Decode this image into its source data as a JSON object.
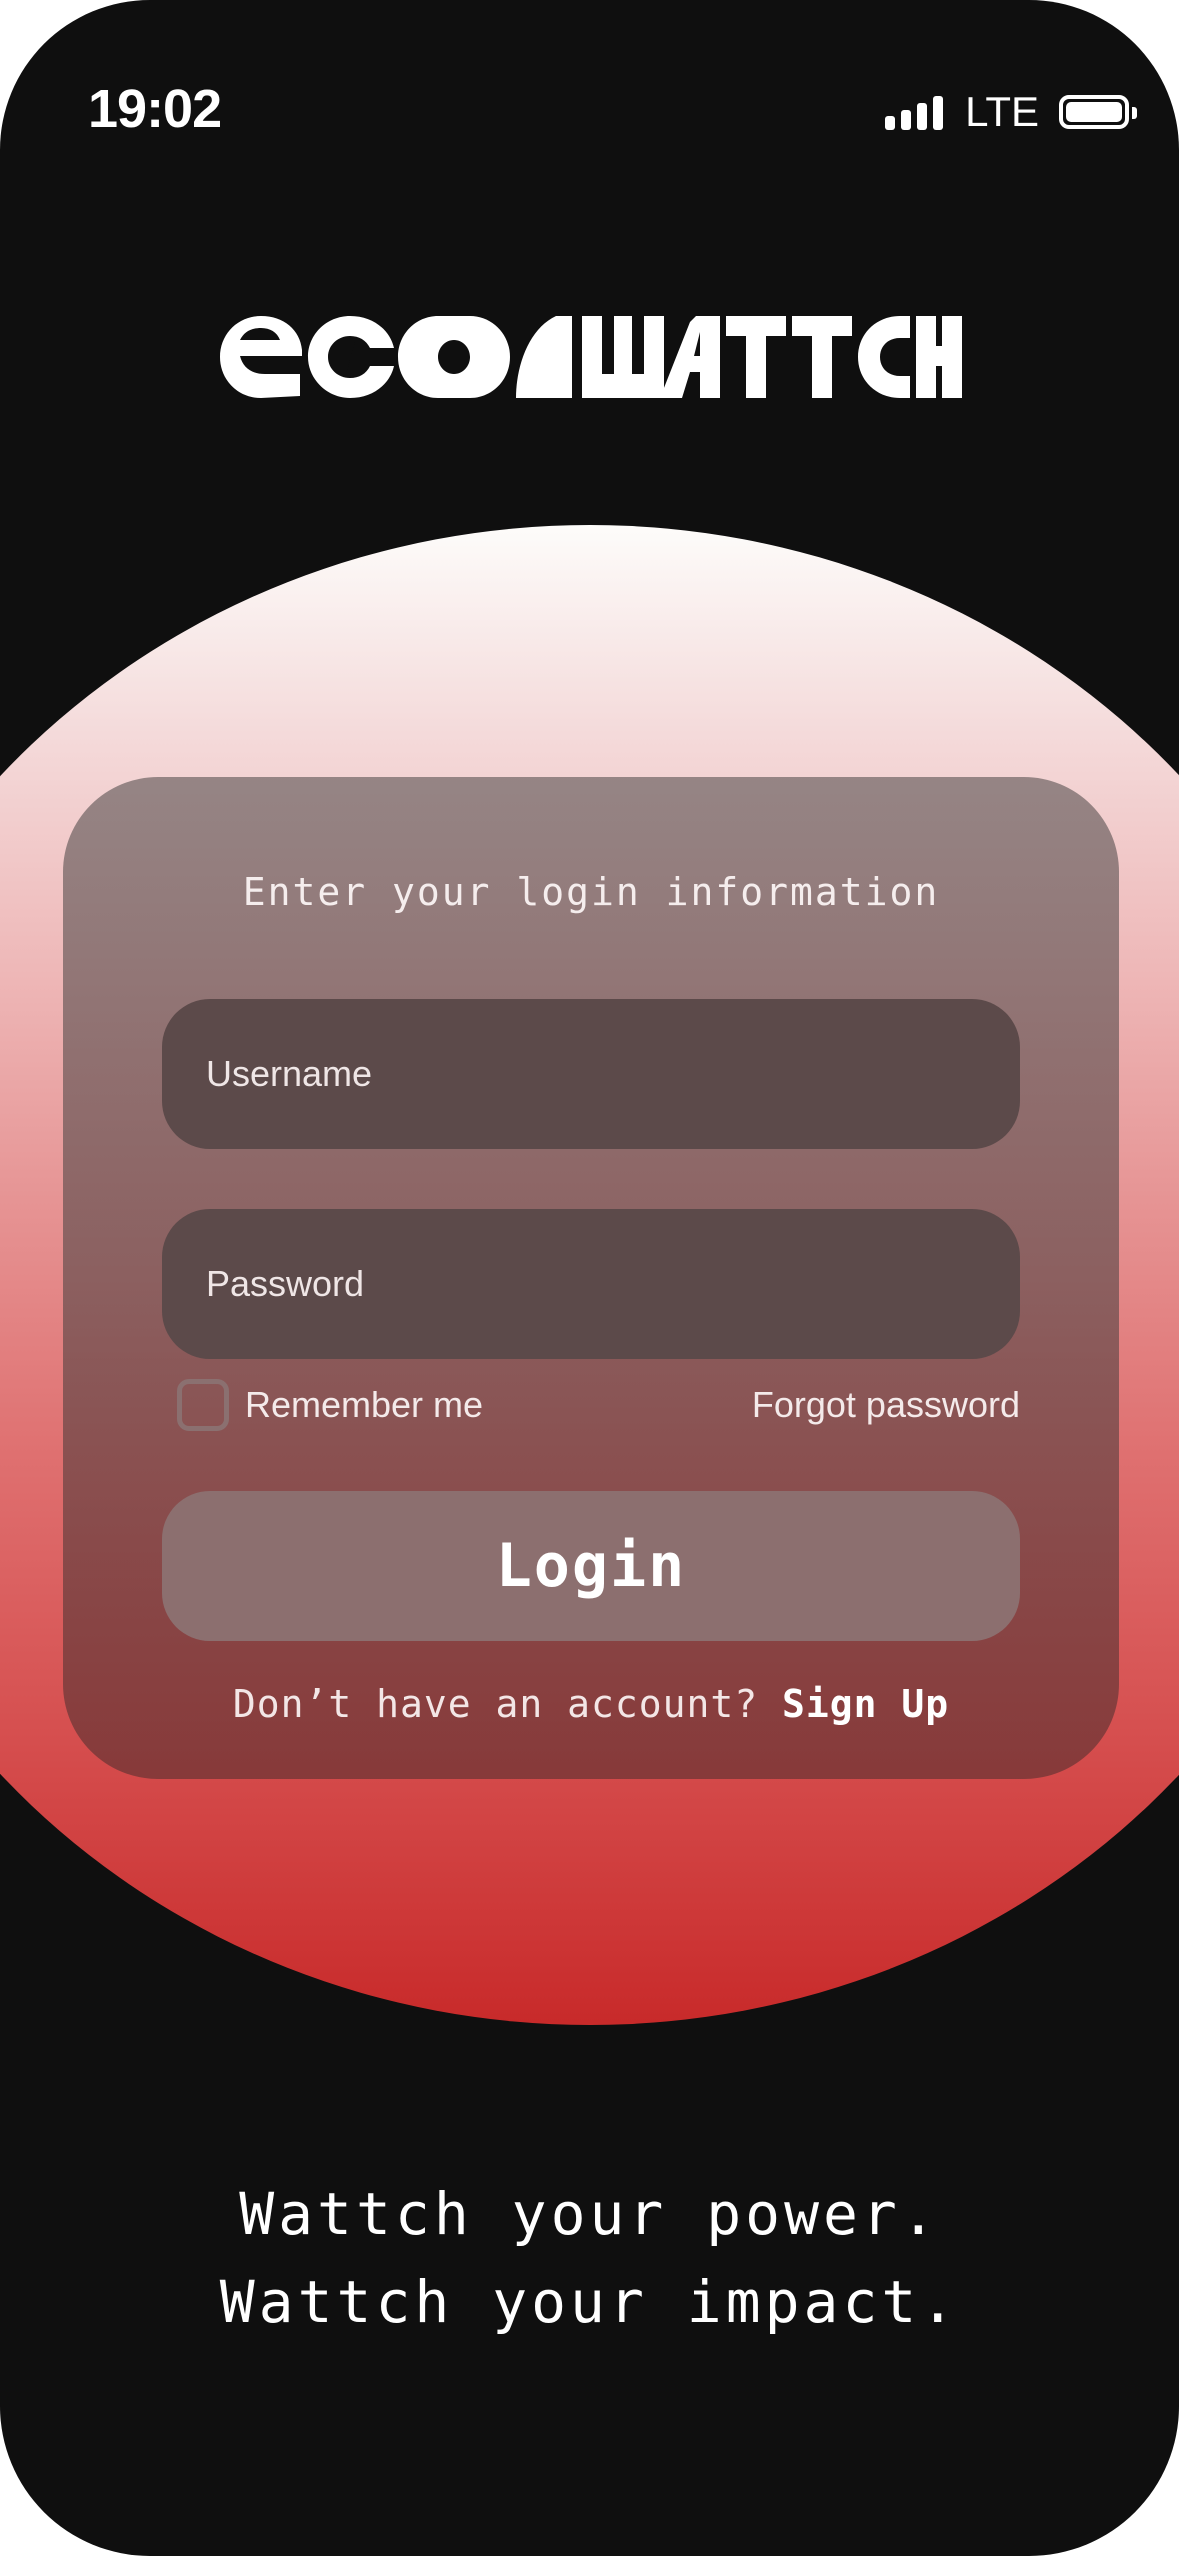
{
  "status_bar": {
    "time": "19:02",
    "network": "LTE",
    "signal-icon": "signal-bars-icon",
    "battery-icon": "battery-icon"
  },
  "brand": {
    "logo_text": "ecowattch"
  },
  "login_card": {
    "heading": "Enter your login information",
    "username_placeholder": "Username",
    "password_placeholder": "Password",
    "remember_label": "Remember me",
    "forgot_label": "Forgot password",
    "login_label": "Login",
    "no_account_text": "Don’t have an account?",
    "signup_label": "Sign Up"
  },
  "tagline": {
    "line1": "Wattch your power.",
    "line2": "Wattch your impact."
  },
  "colors": {
    "background": "#0f0f0f",
    "accent_red": "#c82a2a",
    "field_bg": "#5c4a4a",
    "button_bg": "#8c6f6f"
  }
}
